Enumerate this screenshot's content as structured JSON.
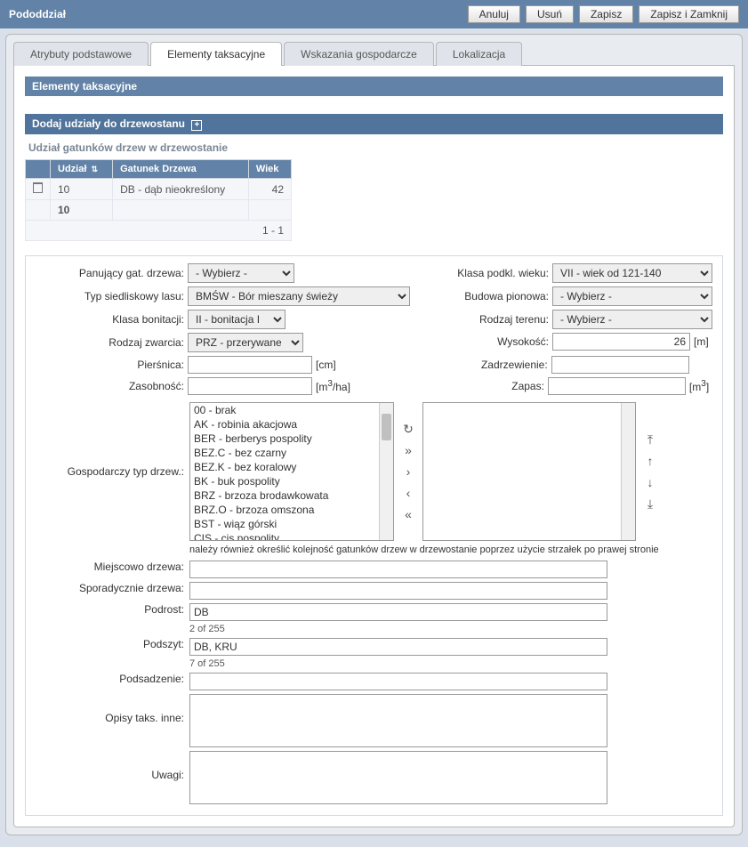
{
  "header": {
    "title": "Pododdział",
    "buttons": {
      "cancel": "Anuluj",
      "delete": "Usuń",
      "save": "Zapisz",
      "saveClose": "Zapisz i Zamknij"
    }
  },
  "tabs": {
    "basic": "Atrybuty podstawowe",
    "tax": "Elementy taksacyjne",
    "eco": "Wskazania gospodarcze",
    "loc": "Lokalizacja",
    "active": "tax"
  },
  "section": {
    "title": "Elementy taksacyjne",
    "addShares": "Dodaj udziały do drzewostanu",
    "sharesCaption": "Udział gatunków drzew w drzewostanie"
  },
  "table": {
    "headers": {
      "udzial": "Udział",
      "gatunek": "Gatunek Drzewa",
      "wiek": "Wiek"
    },
    "rows": [
      {
        "udzial": "10",
        "gatunek": "DB - dąb nieokreślony",
        "wiek": "42"
      }
    ],
    "totalUdzial": "10",
    "pager": "1 - 1"
  },
  "form": {
    "labels": {
      "panujacyGat": "Panujący gat. drzewa:",
      "typSiedl": "Typ siedliskowy lasu:",
      "klasaBon": "Klasa bonitacji:",
      "rodzajZw": "Rodzaj zwarcia:",
      "piersnica": "Pierśnica:",
      "zasobnosc": "Zasobność:",
      "gospTyp": "Gospodarczy typ drzew.:",
      "klasaPodkl": "Klasa podkl. wieku:",
      "budowa": "Budowa pionowa:",
      "rodzajTer": "Rodzaj terenu:",
      "wysokosc": "Wysokość:",
      "zadrzew": "Zadrzewienie:",
      "zapas": "Zapas:",
      "miejscowo": "Miejscowo drzewa:",
      "sporadycznie": "Sporadycznie drzewa:",
      "podrost": "Podrost:",
      "podszyt": "Podszyt:",
      "podsadzenie": "Podsadzenie:",
      "opisyInne": "Opisy taks. inne:",
      "uwagi": "Uwagi:"
    },
    "values": {
      "panujacyGat": "- Wybierz -",
      "typSiedl": "BMŚW - Bór mieszany świeży",
      "klasaBon": "II - bonitacja I",
      "rodzajZw": "PRZ - przerywane",
      "piersnica": "",
      "zasobnosc": "",
      "klasaPodkl": "VII - wiek od 121-140",
      "budowa": "- Wybierz -",
      "rodzajTer": "- Wybierz -",
      "wysokosc": "26",
      "zadrzew": "",
      "zapas": "",
      "miejscowo": "",
      "sporadycznie": "",
      "podrost": "DB",
      "podrostCount": "2 of 255",
      "podszyt": "DB, KRU",
      "podszytCount": "7 of 255",
      "podsadzenie": "",
      "opisyInne": "",
      "uwagi": ""
    },
    "units": {
      "piersnica": "[cm]",
      "zasobnosc_pre": "[m",
      "zasobnosc_sup": "3",
      "zasobnosc_post": "/ha]",
      "wysokosc": "[m]",
      "zapas_pre": "[m",
      "zapas_sup": "3",
      "zapas_post": "]"
    },
    "speciesOptions": [
      "00 - brak",
      "AK - robinia akacjowa",
      "BER - berberys pospolity",
      "BEZ.C - bez czarny",
      "BEZ.K - bez koralowy",
      "BK - buk pospolity",
      "BRZ - brzoza brodawkowata",
      "BRZ.O - brzoza omszona",
      "BST - wiąz górski",
      "CIS - cis pospolity"
    ],
    "helpNote": "należy również określić kolejność gatunków drzew w drzewostanie poprzez użycie strzałek po prawej stronie"
  }
}
